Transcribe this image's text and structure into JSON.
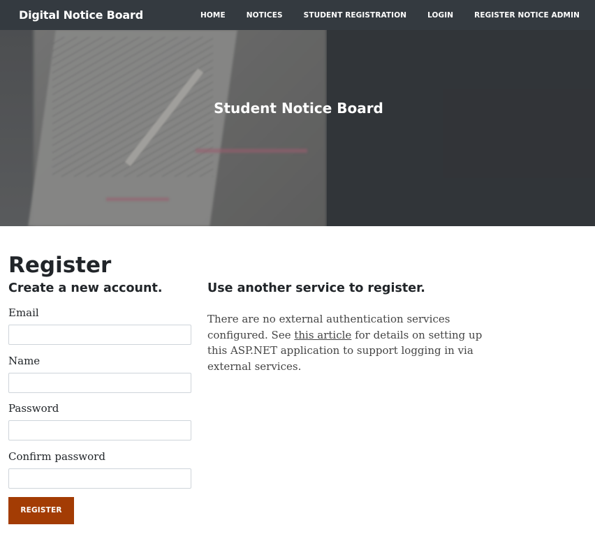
{
  "navbar": {
    "brand": "Digital Notice Board",
    "links": [
      "HOME",
      "NOTICES",
      "STUDENT REGISTRATION",
      "LOGIN",
      "REGISTER NOTICE ADMIN"
    ]
  },
  "hero": {
    "title": "Student Notice Board"
  },
  "page": {
    "title": "Register",
    "left_heading": "Create a new account.",
    "right_heading": "Use another service to register."
  },
  "form": {
    "email_label": "Email",
    "email_value": "",
    "name_label": "Name",
    "name_value": "",
    "password_label": "Password",
    "password_value": "",
    "confirm_label": "Confirm password",
    "confirm_value": "",
    "submit_label": "Register"
  },
  "external": {
    "text_before": "There are no external authentication services configured. See ",
    "link_text": "this article",
    "text_after": " for details on setting up this ASP.NET application to support logging in via external services."
  },
  "colors": {
    "navbar_bg": "#343a40",
    "button_bg": "#a33c04"
  }
}
